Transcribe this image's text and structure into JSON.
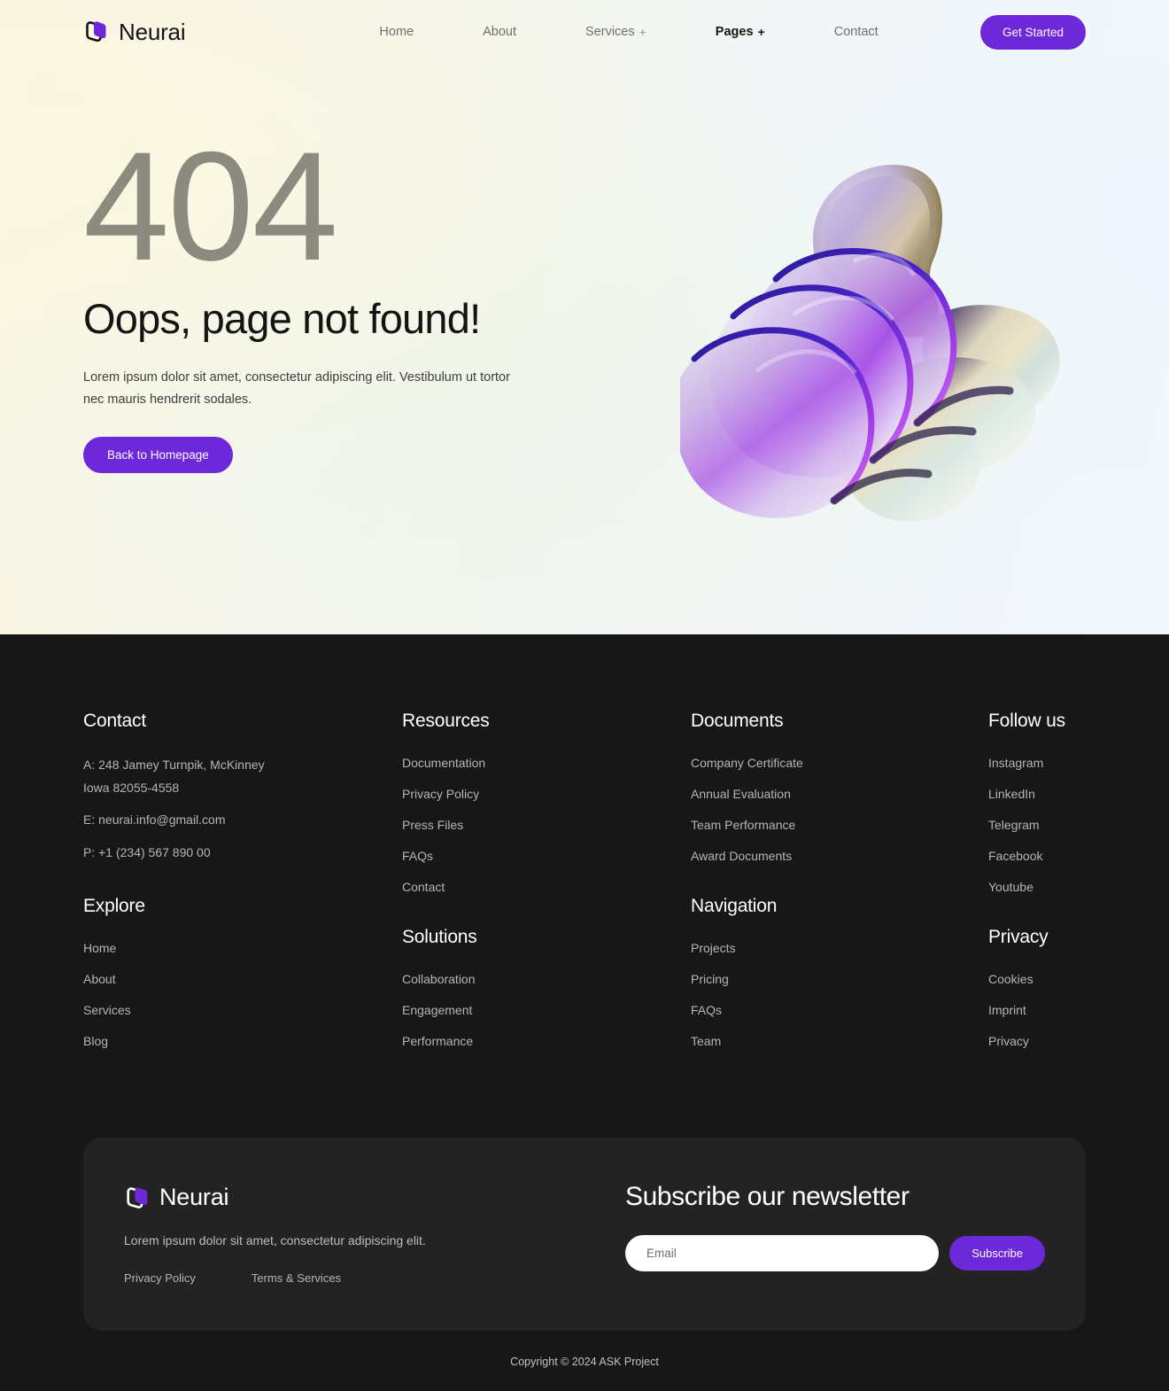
{
  "brand": {
    "name": "Neurai",
    "logo_icon": "neurai-loop-logo",
    "accent_color": "#6d28d9"
  },
  "nav": {
    "items": [
      {
        "label": "Home",
        "has_dropdown": false,
        "active": false
      },
      {
        "label": "About",
        "has_dropdown": false,
        "active": false
      },
      {
        "label": "Services",
        "has_dropdown": true,
        "plus": "+",
        "active": false
      },
      {
        "label": "Pages",
        "has_dropdown": true,
        "plus": "+",
        "active": true
      },
      {
        "label": "Contact",
        "has_dropdown": false,
        "active": false
      }
    ],
    "cta_label": "Get Started"
  },
  "hero": {
    "error_code": "404",
    "title": "Oops, page not found!",
    "description": "Lorem ipsum dolor sit amet, consectetur adipiscing elit. Vestibulum ut tortor nec mauris hendrerit sodales.",
    "button_label": "Back to Homepage",
    "artwork_name": "abstract-3d-iridescent-shape",
    "code_color": "#8b8b80"
  },
  "footer": {
    "contact": {
      "heading": "Contact",
      "address_line1": "A: 248 Jamey Turnpik, McKinney",
      "address_line2": "Iowa 82055-4558",
      "email": "E: neurai.info@gmail.com",
      "phone": "P: +1 (234) 567 890 00"
    },
    "explore": {
      "heading": "Explore",
      "links": [
        "Home",
        "About",
        "Services",
        "Blog"
      ]
    },
    "resources": {
      "heading": "Resources",
      "links": [
        "Documentation",
        "Privacy Policy",
        "Press Files",
        "FAQs",
        "Contact"
      ]
    },
    "solutions": {
      "heading": "Solutions",
      "links": [
        "Collaboration",
        "Engagement",
        "Performance"
      ]
    },
    "documents": {
      "heading": "Documents",
      "links": [
        "Company Certificate",
        "Annual Evaluation",
        "Team Performance",
        "Award Documents"
      ]
    },
    "navigation": {
      "heading": "Navigation",
      "links": [
        "Projects",
        "Pricing",
        "FAQs",
        "Team"
      ]
    },
    "follow": {
      "heading": "Follow us",
      "links": [
        "Instagram",
        "LinkedIn",
        "Telegram",
        "Facebook",
        "Youtube"
      ]
    },
    "privacy": {
      "heading": "Privacy",
      "links": [
        "Cookies",
        "Imprint",
        "Privacy"
      ]
    },
    "newsletter": {
      "brand_name": "Neurai",
      "tagline": "Lorem ipsum dolor sit amet, consectetur adipiscing elit.",
      "legal_links": [
        "Privacy Policy",
        "Terms & Services"
      ],
      "title": "Subscribe our newsletter",
      "email_placeholder": "Email",
      "email_value": "",
      "subscribe_label": "Subscribe"
    },
    "copyright": "Copyright © 2024 ASK Project"
  }
}
